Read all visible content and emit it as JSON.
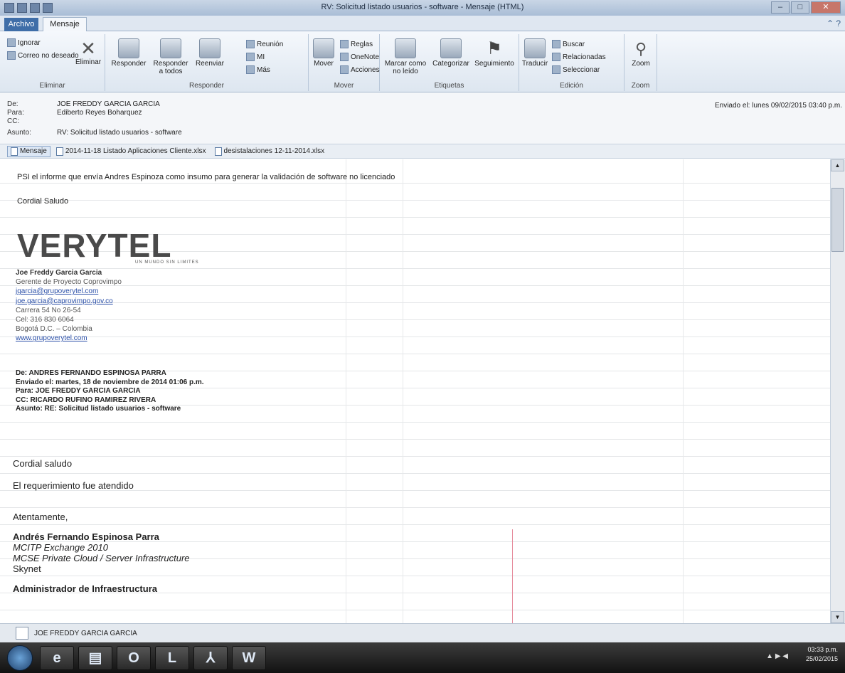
{
  "window": {
    "title": "RV: Solicitud listado usuarios - software - Mensaje (HTML)",
    "minimize": "–",
    "maximize": "□",
    "close": "✕"
  },
  "tabs": {
    "file": "Archivo",
    "message": "Mensaje"
  },
  "ribbon": {
    "delete_group": {
      "ignore": "Ignorar",
      "junk": "Correo no deseado",
      "delete": "Eliminar",
      "label": "Eliminar"
    },
    "respond_group": {
      "reply": "Responder",
      "reply_all": "Responder a todos",
      "forward": "Reenviar",
      "meeting": "Reunión",
      "im": "MI",
      "more": "Más",
      "label": "Responder"
    },
    "move_group": {
      "move": "Mover",
      "rules": "Reglas",
      "onenote": "OneNote",
      "actions": "Acciones",
      "label": "Mover"
    },
    "tags_group": {
      "mark_unread": "Marcar como no leído",
      "categorize": "Categorizar",
      "followup": "Seguimiento",
      "label": "Etiquetas"
    },
    "edit_group": {
      "translate": "Traducir",
      "find": "Buscar",
      "related": "Relacionadas",
      "select": "Seleccionar",
      "label": "Edición"
    },
    "zoom_group": {
      "zoom": "Zoom",
      "label": "Zoom"
    }
  },
  "header": {
    "from_label": "De:",
    "from": "JOE FREDDY GARCIA GARCIA",
    "to_label": "Para:",
    "to": "Ediberto Reyes Boharquez",
    "cc_label": "CC:",
    "cc": "",
    "subject_label": "Asunto:",
    "subject": "RV: Solicitud listado usuarios - software",
    "sent": "Enviado el: lunes 09/02/2015 03:40 p.m."
  },
  "attachments": [
    "Mensaje",
    "2014-11-18 Listado Aplicaciones Cliente.xlsx",
    "desistalaciones 12-11-2014.xlsx"
  ],
  "message": {
    "intro": "PSI el informe que envía Andres Espinoza como insumo para generar la validación de software no licenciado",
    "greeting": "Cordial Saludo",
    "logo": "VERYTEL",
    "tagline": "UN MUNDO SIN LIMITES",
    "signature": {
      "name": "Joe Freddy Garcia Garcia",
      "role": "Gerente de Proyecto Coprovimpo",
      "email1": "jgarcia@grupoverytel.com",
      "email2": "joe.garcia@caprovimpo.gov.co",
      "address": "Carrera 54 No 26-54",
      "cel": "Cel: 316 830 6064",
      "city": "Bogotá D.C. – Colombia",
      "web": "www.grupoverytel.com"
    },
    "forwarded": {
      "from": "De: ANDRES FERNANDO ESPINOSA PARRA",
      "sent": "Enviado el: martes, 18 de noviembre de 2014 01:06 p.m.",
      "to": "Para: JOE FREDDY GARCIA GARCIA",
      "cc": "CC: RICARDO RUFINO RAMIREZ RIVERA",
      "subject": "Asunto: RE: Solicitud listado usuarios - software"
    },
    "reply_greeting": "Cordial saludo",
    "reply_text": "El requerimiento fue atendido",
    "closing": "Atentamente,",
    "reply_sig": {
      "name": "Andrés Fernando Espinosa Parra",
      "cert1": "MCITP Exchange 2010",
      "cert2": "MCSE Private Cloud / Server Infrastructure",
      "company": "Skynet"
    },
    "admin": "Administrador de Infraestructura"
  },
  "people_pane": {
    "contact": "JOE FREDDY GARCIA GARCIA"
  },
  "taskbar": {
    "time": "03:33 p.m.",
    "date": "25/02/2015"
  }
}
